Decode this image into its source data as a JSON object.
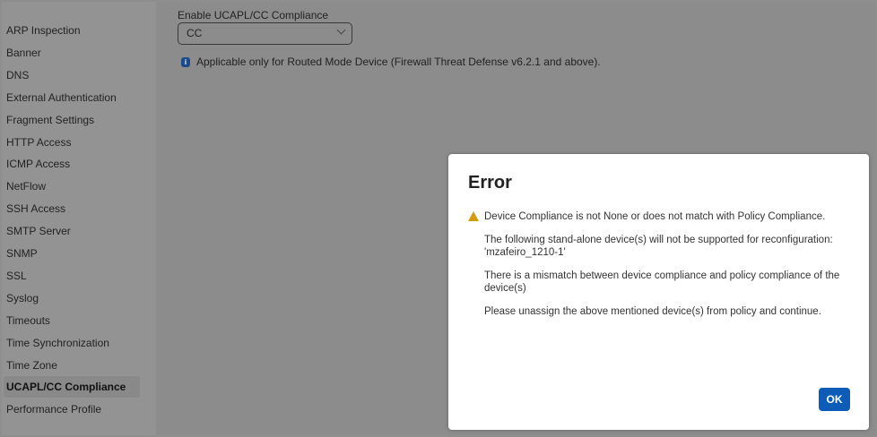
{
  "sidebar": {
    "items": [
      "ARP Inspection",
      "Banner",
      "DNS",
      "External Authentication",
      "Fragment Settings",
      "HTTP Access",
      "ICMP Access",
      "NetFlow",
      "SSH Access",
      "SMTP Server",
      "SNMP",
      "SSL",
      "Syslog",
      "Timeouts",
      "Time Synchronization",
      "Time Zone",
      "UCAPL/CC Compliance",
      "Performance Profile"
    ],
    "active": "UCAPL/CC Compliance"
  },
  "main": {
    "label": "Enable UCAPL/CC Compliance",
    "select_value": "CC",
    "info_icon": "info-icon",
    "info_text": "Applicable only for Routed Mode Device (Firewall Threat Defense v6.2.1 and above)."
  },
  "dialog": {
    "title": "Error",
    "warning_icon": "warning-icon",
    "line1": "Device Compliance is not None or does not match with Policy Compliance.",
    "line2": "The following stand-alone device(s) will not be supported for reconfiguration: 'mzafeiro_1210-1'",
    "line3": "There is a mismatch between device compliance and policy compliance of the device(s)",
    "line4": "Please unassign the above mentioned device(s) from policy and continue.",
    "ok_label": "OK"
  }
}
